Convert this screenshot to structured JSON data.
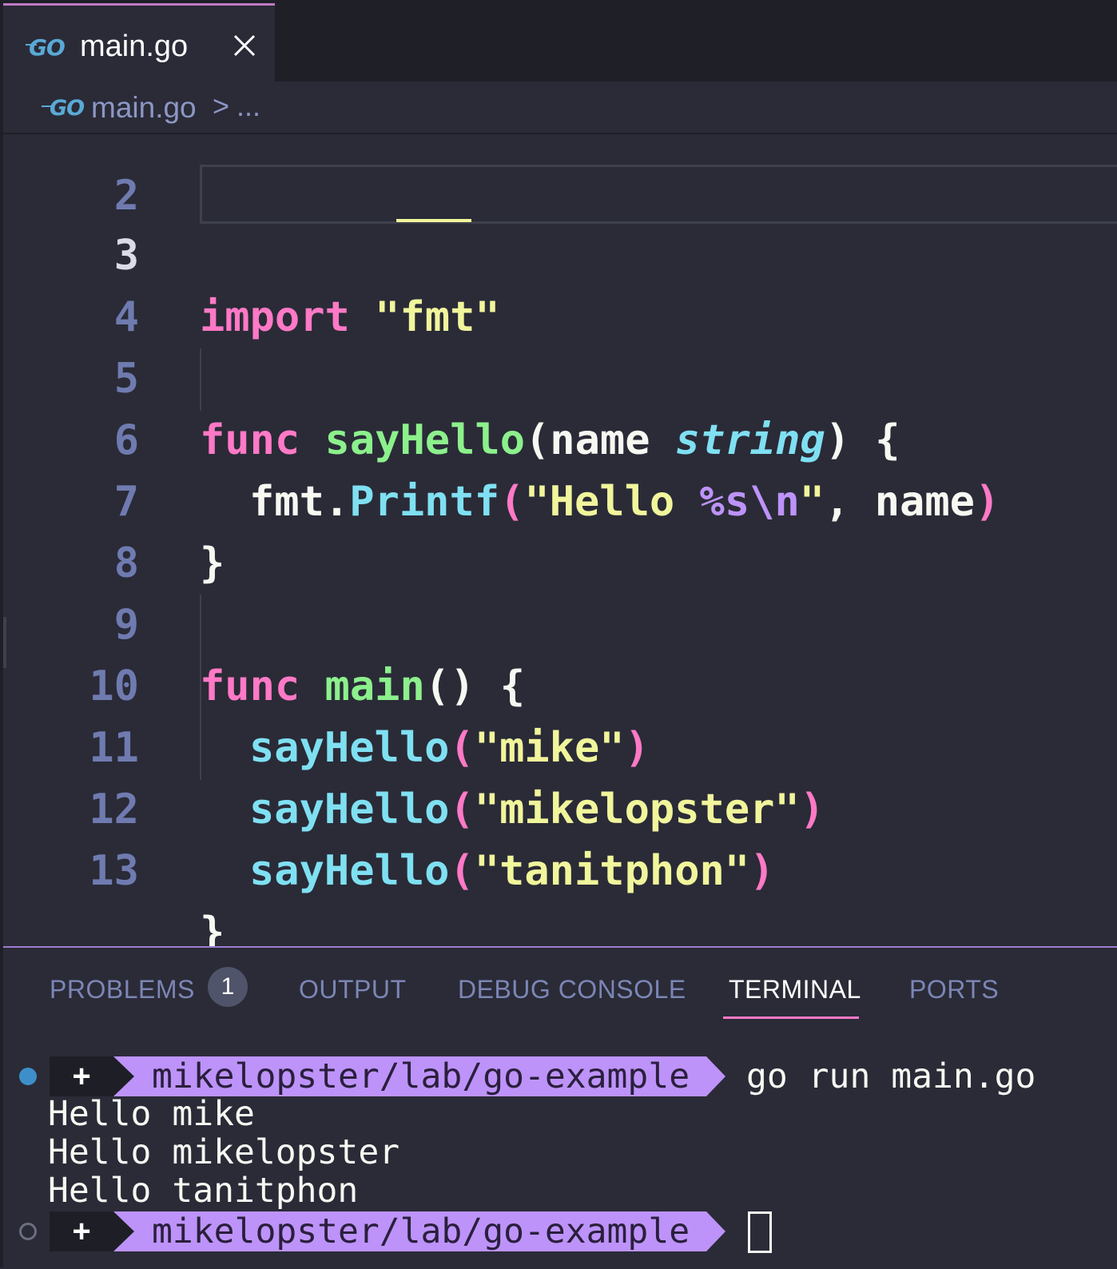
{
  "tab": {
    "title": "main.go",
    "icon": "go-file-icon"
  },
  "breadcrumb": {
    "file": "main.go",
    "separator": ">",
    "more": "..."
  },
  "editor": {
    "partial_line_number": "2",
    "lines": [
      {
        "num": "3"
      },
      {
        "num": "4"
      },
      {
        "num": "5"
      },
      {
        "num": "6"
      },
      {
        "num": "7"
      },
      {
        "num": "8"
      },
      {
        "num": "9"
      },
      {
        "num": "10"
      },
      {
        "num": "11"
      },
      {
        "num": "12"
      },
      {
        "num": "13"
      }
    ],
    "tokens": {
      "import_kw": "import",
      "import_q1": "\"",
      "import_pkg": "fmt",
      "import_q2": "\"",
      "func_kw": "func",
      "sayhello_name": "sayHello",
      "sig_open": "(name ",
      "sig_type": "string",
      "sig_close": ") {",
      "fmt_pkg": "fmt.",
      "printf": "Printf",
      "printf_open": "(",
      "hello_str_a": "\"Hello ",
      "hello_fmt": "%s\\n",
      "hello_str_b": "\"",
      "printf_args": ", name",
      "printf_close": ")",
      "close_brace": "}",
      "main_name": "main",
      "main_sig": "() {",
      "call_name": "sayHello",
      "call_open": "(",
      "call_close": ")",
      "arg1": "\"mike\"",
      "arg2": "\"mikelopster\"",
      "arg3": "\"tanitphon\""
    }
  },
  "panel": {
    "tabs": [
      "PROBLEMS",
      "OUTPUT",
      "DEBUG CONSOLE",
      "TERMINAL",
      "PORTS"
    ],
    "active_tab": "TERMINAL",
    "problems_count": "1"
  },
  "terminal": {
    "plus_glyph": "+",
    "path": "mikelopster/lab/go-example",
    "command": "go run main.go",
    "output": [
      "Hello mike",
      "Hello mikelopster",
      "Hello tanitphon"
    ]
  }
}
